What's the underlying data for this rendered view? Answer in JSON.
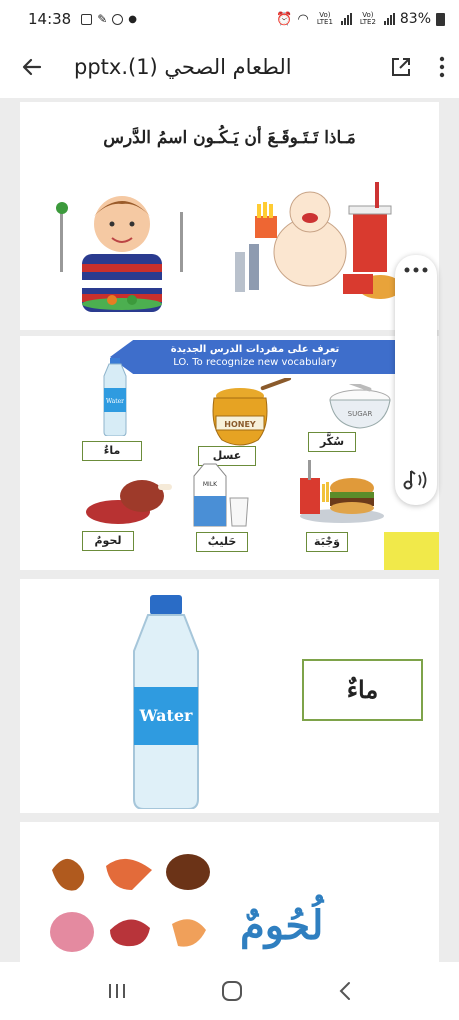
{
  "status": {
    "time": "14:38",
    "network1": "Vo) LTE1",
    "network2": "Vo) LTE2",
    "battery": "83%"
  },
  "appbar": {
    "title": "pptx.(1) الطعام الصحي"
  },
  "slides": {
    "slide1": {
      "question": "مَـاذا تَـتَـوقَـعَ أن يَـكُـون اسمُ الدَّرس"
    },
    "slide2": {
      "banner_ar": "تعرف على مفردات الدرس الجديدة",
      "banner_en": "LO. To recognize new vocabulary",
      "water_bottle_text": "Water",
      "honey_text": "HONEY",
      "sugar_text": "SUGAR",
      "milk_text": "MILK",
      "labels": {
        "water": "ماءٌ",
        "honey": "عسل",
        "sugar": "سُكَّر",
        "meat": "لحومٌ",
        "milk": "حَليبٌ",
        "meal": "وَجْبَة"
      }
    },
    "slide3": {
      "bottle_text": "Water",
      "word": "ماءٌ"
    },
    "slide4": {
      "word": "لُحُومٌ"
    }
  },
  "colors": {
    "accent_blue": "#3e6ecb",
    "label_border": "#7ea34a",
    "meat_word": "#2f7fc0"
  }
}
